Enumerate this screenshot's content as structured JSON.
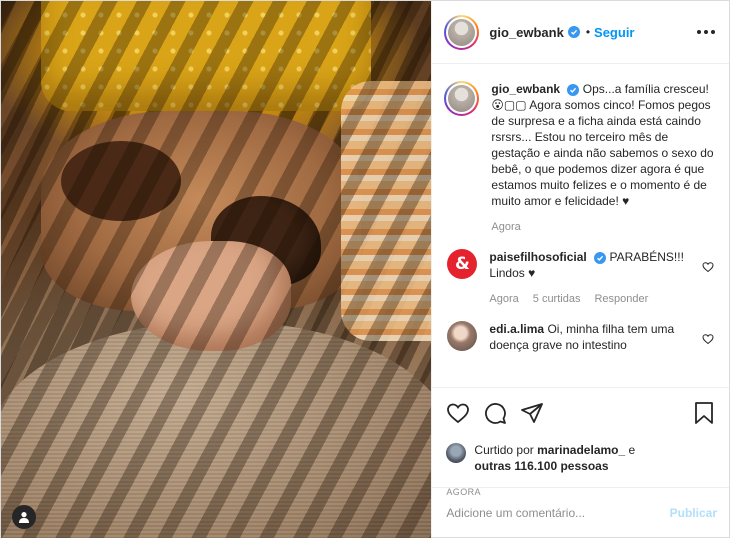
{
  "post": {
    "author": {
      "username": "gio_ewbank",
      "verified": true,
      "follow_label": "Seguir",
      "separator": "•"
    },
    "caption": {
      "username": "gio_ewbank",
      "text": "Ops...a família cresceu! 😮▢▢ Agora somos cinco! Fomos pegos de surpresa e a ficha ainda está caindo rsrsrs... Estou no terceiro mês de gestação e ainda não sabemos o sexo do bebê, o que podemos dizer agora é que estamos muito felizes e o momento é de muito amor e felicidade! ♥",
      "time": "Agora"
    },
    "comments": [
      {
        "username": "paisefilhosoficial",
        "verified": true,
        "text": "PARABÉNS!!! Lindos ♥",
        "time": "Agora",
        "likes": "5 curtidas",
        "reply_label": "Responder",
        "avatar_glyph": "&"
      },
      {
        "username": "edi.a.lima",
        "verified": false,
        "text": "Oi, minha filha tem uma doença grave no intestino"
      }
    ],
    "likes": {
      "prefix": "Curtido por",
      "user": "marinadelamo_",
      "connector": "e",
      "others": "outras 116.100 pessoas"
    },
    "timestamp": "Agora",
    "add_comment": {
      "placeholder": "Adicione um comentário...",
      "publish_label": "Publicar"
    }
  },
  "icons": {
    "user_tag": "user-silhouette-icon",
    "more": "more-options-icon",
    "like": "heart-icon",
    "comment": "comment-icon",
    "share": "paper-plane-icon",
    "save": "bookmark-icon",
    "verified": "verified-badge-icon"
  },
  "colors": {
    "link": "#0095f6",
    "verified": "#3897f0",
    "muted": "#8e8e8e",
    "text": "#262626",
    "publish_disabled": "#b2dffc",
    "brand_red": "#e5232e"
  }
}
